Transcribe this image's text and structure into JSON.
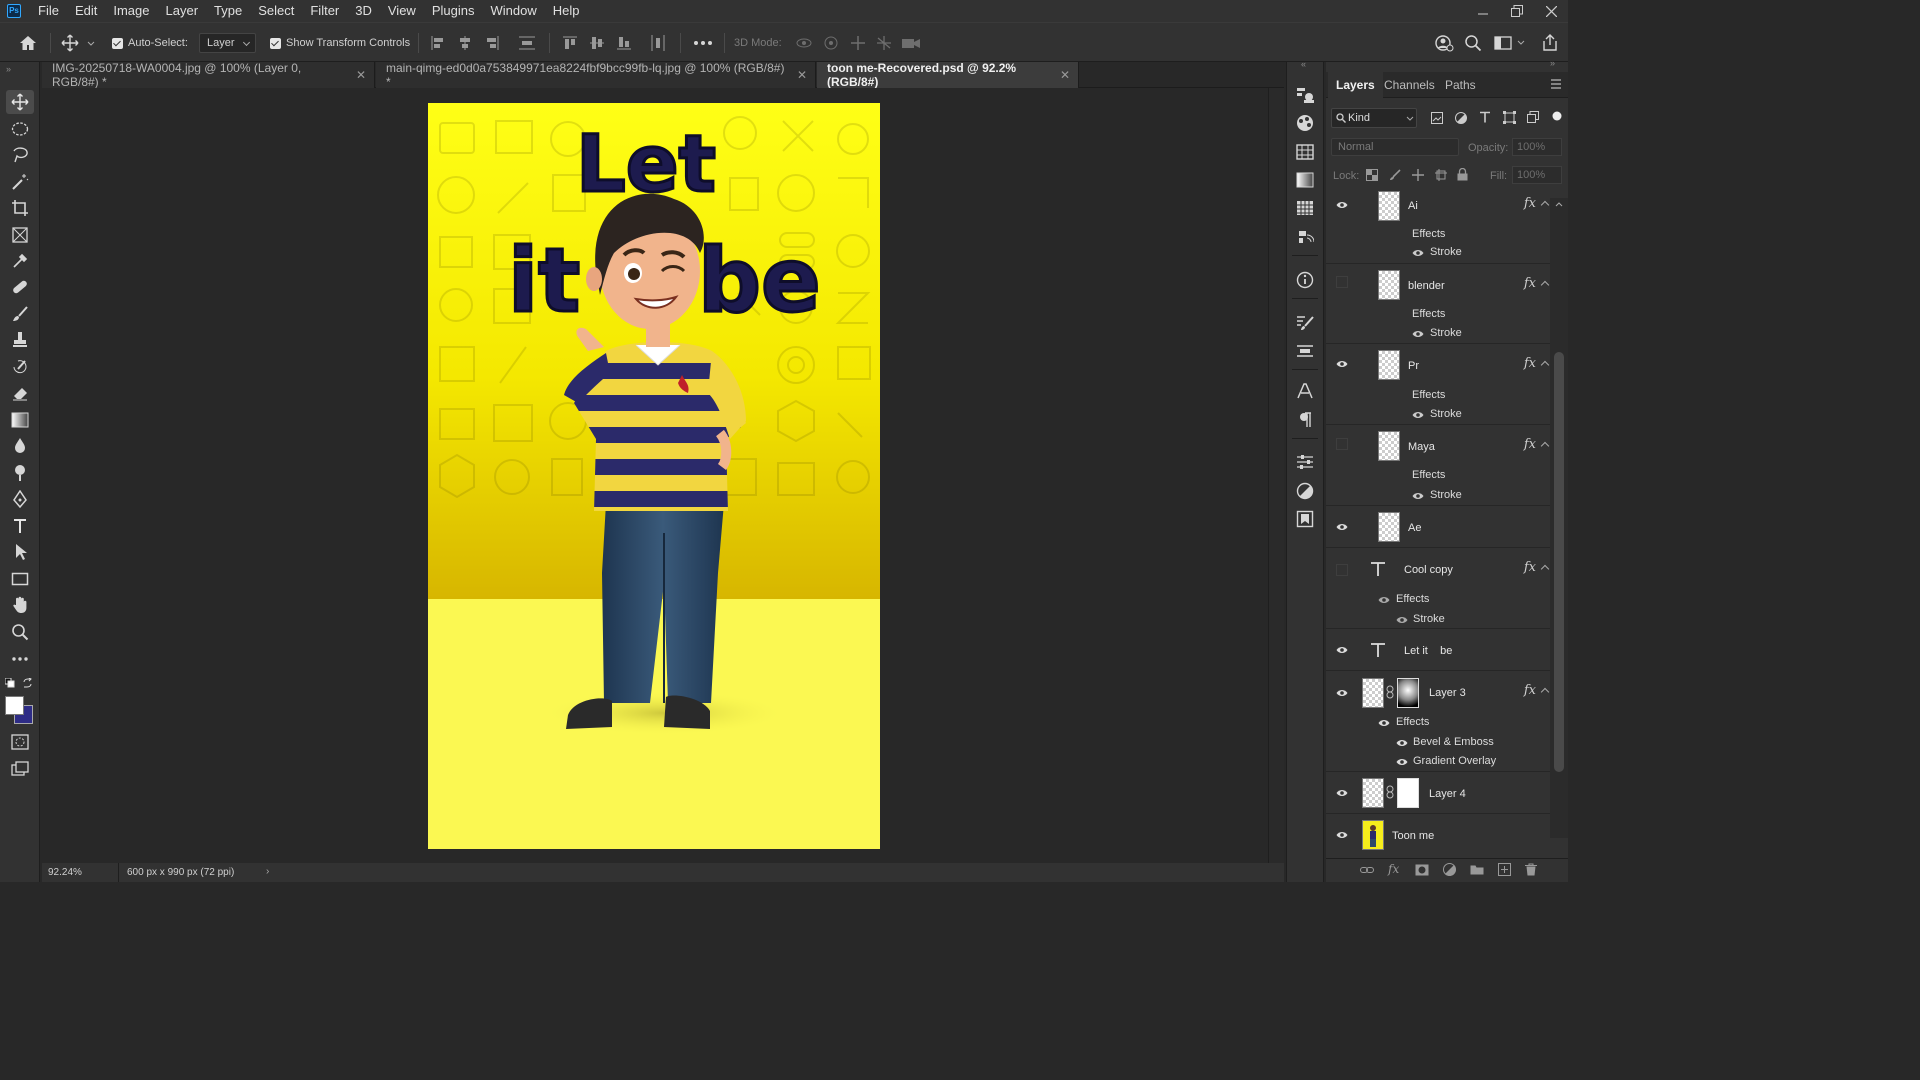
{
  "menu": [
    "File",
    "Edit",
    "Image",
    "Layer",
    "Type",
    "Select",
    "Filter",
    "3D",
    "View",
    "Plugins",
    "Window",
    "Help"
  ],
  "options": {
    "auto_select_label": "Auto-Select:",
    "auto_select_value": "Layer",
    "show_transform_label": "Show Transform Controls",
    "mode_3d_label": "3D Mode:"
  },
  "tabs": [
    {
      "label": "IMG-20250718-WA0004.jpg @ 100% (Layer 0, RGB/8#) *",
      "active": false
    },
    {
      "label": "main-qimg-ed0d0a753849971ea8224fbf9bcc99fb-lq.jpg @ 100% (RGB/8#) *",
      "active": false
    },
    {
      "label": "toon me-Recovered.psd @ 92.2% (RGB/8#)",
      "active": true
    }
  ],
  "canvas_text": {
    "line1": "Let",
    "line2a": "it",
    "line2b": "be"
  },
  "status": {
    "zoom": "92.24%",
    "doc_info": "600 px x 990 px (72 ppi)"
  },
  "panel": {
    "tabs": [
      "Layers",
      "Channels",
      "Paths"
    ],
    "filter_kind": "Kind",
    "blend_mode": "Normal",
    "opacity_label": "Opacity:",
    "opacity_value": "100%",
    "lock_label": "Lock:",
    "fill_label": "Fill:",
    "fill_value": "100%"
  },
  "layers": [
    {
      "name": "Ai",
      "visible": true,
      "fx": true,
      "effects": [
        "Stroke"
      ]
    },
    {
      "name": "blender",
      "visible": false,
      "fx": true,
      "effects": [
        "Stroke"
      ]
    },
    {
      "name": "Pr",
      "visible": true,
      "fx": true,
      "effects": [
        "Stroke"
      ]
    },
    {
      "name": "Maya",
      "visible": false,
      "fx": true,
      "effects": [
        "Stroke"
      ]
    },
    {
      "name": "Ae",
      "visible": true,
      "fx": false,
      "effects": []
    },
    {
      "name": "Cool copy",
      "visible": false,
      "fx": true,
      "type": "text",
      "effects": [
        "Stroke"
      ]
    },
    {
      "name": "Let it    be",
      "visible": true,
      "fx": false,
      "type": "text",
      "effects": []
    },
    {
      "name": "Layer 3",
      "visible": true,
      "fx": true,
      "effects": [
        "Bevel & Emboss",
        "Gradient Overlay"
      ]
    },
    {
      "name": "Layer 4",
      "visible": true,
      "fx": false,
      "effects": []
    },
    {
      "name": "Toon me",
      "visible": true,
      "fx": false,
      "effects": []
    }
  ],
  "effects_label": "Effects",
  "colors": {
    "accent": "#31a8ff",
    "canvas_yellow": "#ffff1a",
    "text_navy": "#1d1b4e"
  }
}
